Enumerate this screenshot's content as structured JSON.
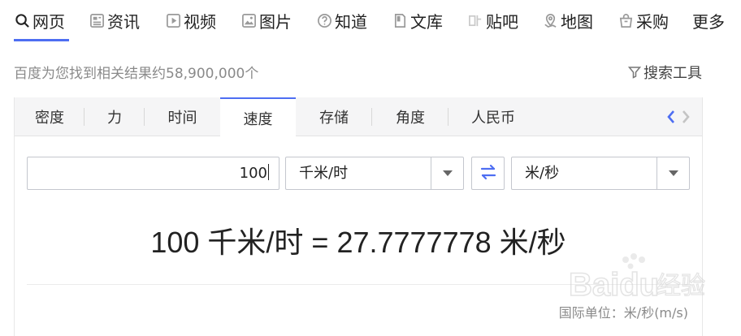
{
  "nav": {
    "items": [
      {
        "label": "网页",
        "icon": "search-icon",
        "active": true
      },
      {
        "label": "资讯",
        "icon": "news-icon"
      },
      {
        "label": "视频",
        "icon": "video-icon"
      },
      {
        "label": "图片",
        "icon": "image-icon"
      },
      {
        "label": "知道",
        "icon": "question-icon"
      },
      {
        "label": "文库",
        "icon": "document-icon"
      },
      {
        "label": "贴吧",
        "icon": "tieba-icon"
      },
      {
        "label": "地图",
        "icon": "map-icon"
      },
      {
        "label": "采购",
        "icon": "shopping-bag-icon"
      },
      {
        "label": "更多"
      }
    ]
  },
  "stats": {
    "text": "百度为您找到相关结果约58,900,000个"
  },
  "tools": {
    "label": "搜索工具",
    "icon": "filter-icon"
  },
  "converter": {
    "tabs": [
      {
        "label": "密度"
      },
      {
        "label": "力"
      },
      {
        "label": "时间"
      },
      {
        "label": "速度",
        "active": true
      },
      {
        "label": "存储"
      },
      {
        "label": "角度"
      },
      {
        "label": "人民币"
      }
    ],
    "input_value": "100",
    "from_unit": "千米/时",
    "to_unit": "米/秒",
    "result_text": "100 千米/时 = 27.7777778 米/秒",
    "si_unit_text": "国际单位：米/秒(m/s)",
    "accent_color": "#4e6ef2"
  },
  "watermark": {
    "brand": "Baidu",
    "text": "经验"
  }
}
